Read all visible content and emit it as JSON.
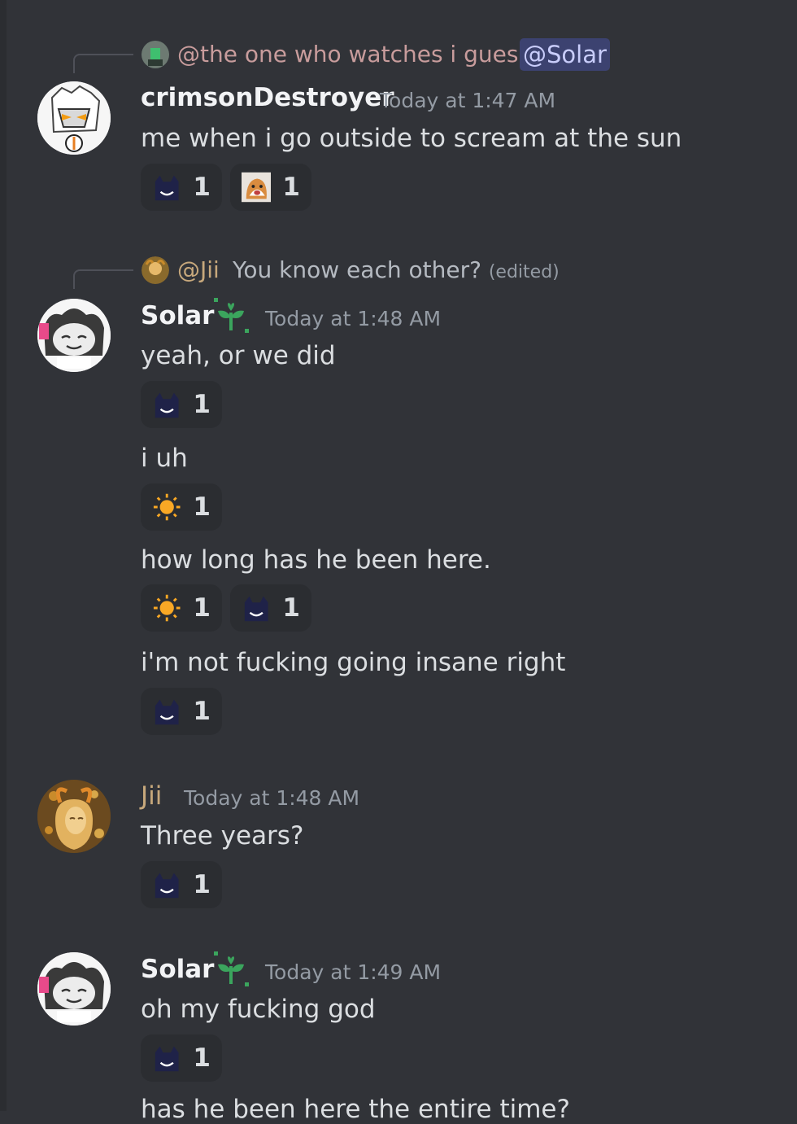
{
  "messages": [
    {
      "reply": {
        "author_mention": "@the one who watches i guess",
        "mention": "@Solar"
      },
      "author": "crimsonDestroyer",
      "timestamp": "Today at 1:47 AM",
      "text": "me when i go outside to scream at the sun",
      "reactions": [
        {
          "emoji": "cat-face-emoji",
          "count": "1"
        },
        {
          "emoji": "dog-emoji",
          "count": "1"
        }
      ]
    },
    {
      "reply": {
        "author_mention": "@Jii",
        "text": "You know each other?",
        "edited": "(edited)"
      },
      "author": "Solar",
      "timestamp": "Today at 1:48 AM",
      "text": "yeah, or we did",
      "reactions": [
        {
          "emoji": "cat-face-emoji",
          "count": "1"
        }
      ]
    },
    {
      "text": "i uh",
      "reactions": [
        {
          "emoji": "sun-emoji",
          "count": "1"
        }
      ]
    },
    {
      "text": "how long has he been here.",
      "reactions": [
        {
          "emoji": "sun-emoji",
          "count": "1"
        },
        {
          "emoji": "cat-face-emoji",
          "count": "1"
        }
      ]
    },
    {
      "text": "i'm not fucking going insane right",
      "reactions": [
        {
          "emoji": "cat-face-emoji",
          "count": "1"
        }
      ]
    },
    {
      "author": "Jii",
      "timestamp": "Today at 1:48 AM",
      "text": "Three years?",
      "reactions": [
        {
          "emoji": "cat-face-emoji",
          "count": "1"
        }
      ]
    },
    {
      "author": "Solar",
      "timestamp": "Today at 1:49 AM",
      "text": "oh my fucking god",
      "reactions": [
        {
          "emoji": "cat-face-emoji",
          "count": "1"
        }
      ]
    },
    {
      "text": "has he been here the entire time?"
    }
  ],
  "colors": {
    "background": "#313338",
    "reaction_bg": "#2b2d31",
    "mention_bg": "#3c4270",
    "jii_name": "#c7a87c",
    "reply_mention": "#c89c9c"
  }
}
